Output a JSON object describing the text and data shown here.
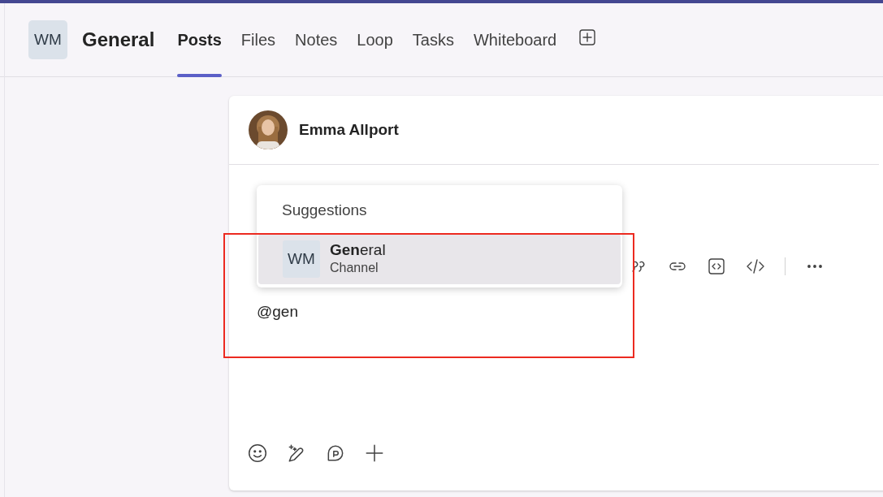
{
  "header": {
    "avatar": "WM",
    "title": "General",
    "tabs": [
      {
        "label": "Posts",
        "selected": true
      },
      {
        "label": "Files",
        "selected": false
      },
      {
        "label": "Notes",
        "selected": false
      },
      {
        "label": "Loop",
        "selected": false
      },
      {
        "label": "Tasks",
        "selected": false
      },
      {
        "label": "Whiteboard",
        "selected": false
      }
    ]
  },
  "composer": {
    "author": "Emma Allport",
    "message": "@gen"
  },
  "suggestions": {
    "heading": "Suggestions",
    "items": [
      {
        "avatar": "WM",
        "name": "**Gen**eral",
        "subtitle": "Channel",
        "selected": true
      }
    ]
  }
}
